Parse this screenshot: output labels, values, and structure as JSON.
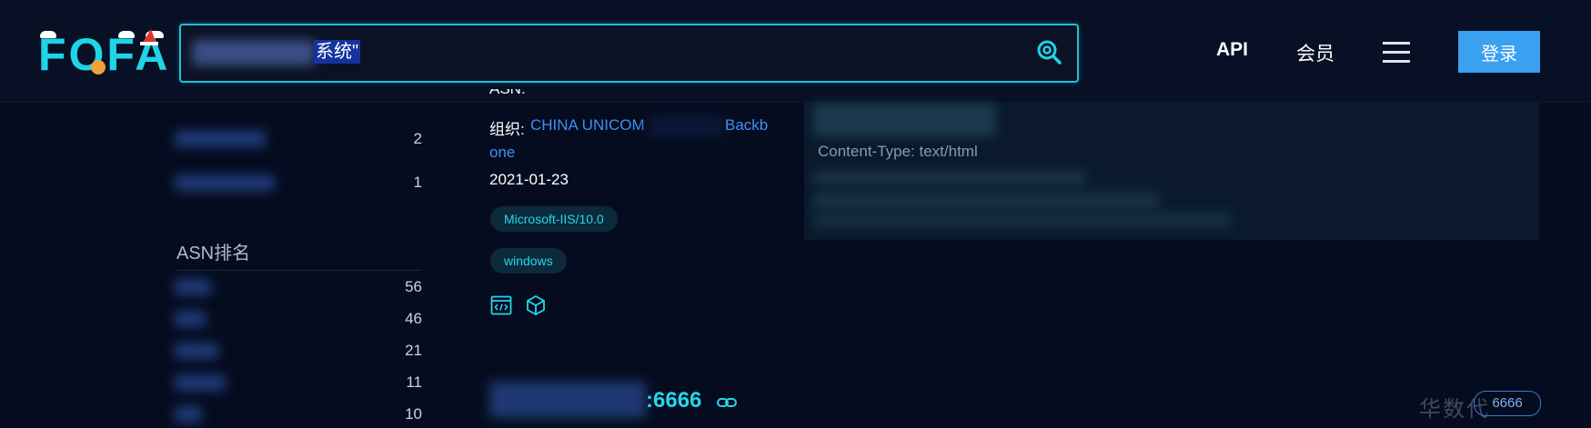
{
  "header": {
    "logo_text": "FOFA",
    "search": {
      "query_visible": "系统\""
    },
    "nav": {
      "api": "API",
      "vip": "会员",
      "login": "登录"
    }
  },
  "sidebar": {
    "top_counts": [
      "2",
      "1"
    ],
    "asn_title": "ASN排名",
    "asn_counts": [
      "56",
      "46",
      "21",
      "11",
      "10"
    ]
  },
  "result": {
    "asn_label_fragment": "ASN:",
    "org_label": "组织:",
    "org_value_start": "CHINA UNICOM",
    "org_value_end_line1": "Backb",
    "org_value_line2": "one",
    "date": "2021-01-23",
    "tags": [
      "Microsoft-IIS/10.0",
      "windows"
    ],
    "next_port": ":6666"
  },
  "panel": {
    "content_type": "Content-Type: text/html"
  },
  "watermark": {
    "text": "华数代",
    "badge": "6666"
  }
}
